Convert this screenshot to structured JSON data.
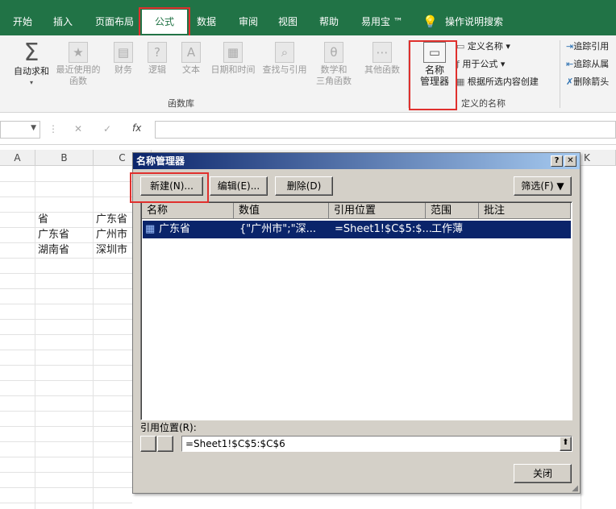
{
  "tabs": [
    "开始",
    "插入",
    "页面布局",
    "公式",
    "数据",
    "审阅",
    "视图",
    "帮助",
    "易用宝 ™",
    "操作说明搜索"
  ],
  "ribbon": {
    "autosum": "自动求和",
    "recent": [
      "最近使用的",
      "函数"
    ],
    "finance": "财务",
    "logic": "逻辑",
    "text": "文本",
    "datetime": "日期和时间",
    "lookup": "查找与引用",
    "math": [
      "数学和",
      "三角函数"
    ],
    "other": "其他函数",
    "group_funclib": "函数库",
    "name_manager": [
      "名称",
      "管理器"
    ],
    "define_name": "定义名称",
    "use_in_formula": "用于公式",
    "create_from_sel": "根据所选内容创建",
    "group_defined": "定义的名称",
    "trace_prec": "追踪引用",
    "trace_dep": "追踪从属",
    "remove_arrows": "删除箭头"
  },
  "formula_bar": {
    "fx": "fx",
    "cancel": "✕",
    "enter": "✓"
  },
  "columns": [
    "A",
    "B",
    "C",
    "K"
  ],
  "cells": {
    "b1": "省",
    "c1": "广东省",
    "b2": "广东省",
    "c2": "广州市",
    "b3": "湖南省",
    "c3": "深圳市"
  },
  "dialog": {
    "title": "名称管理器",
    "help": "?",
    "close_x": "✕",
    "new": "新建(N)...",
    "edit": "编辑(E)...",
    "delete": "删除(D)",
    "filter": "筛选(F)",
    "headers": [
      "名称",
      "数值",
      "引用位置",
      "范围",
      "批注"
    ],
    "row": {
      "name": "广东省",
      "value": "{\"广州市\";\"深...",
      "refers": "=Sheet1!$C$5:$...",
      "scope": "工作薄",
      "comment": ""
    },
    "ref_label": "引用位置(R):",
    "ref_value": "=Sheet1!$C$5:$C$6",
    "close": "关闭"
  },
  "colors": {
    "excel_green": "#217346",
    "highlight_red": "#e0302d",
    "selection": "#0a246a"
  }
}
